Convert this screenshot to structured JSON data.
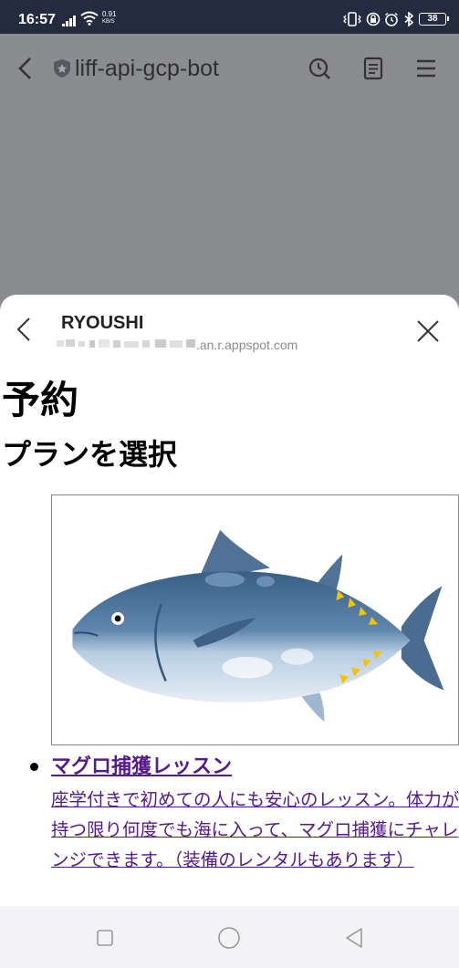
{
  "status_bar": {
    "time": "16:57",
    "net_speed_value": "0.91",
    "net_speed_unit": "KB/S",
    "battery": "38"
  },
  "header": {
    "title": "liff-api-gcp-bot",
    "icons": [
      "back-arrow-icon",
      "shield-icon",
      "history-icon",
      "note-icon",
      "menu-icon"
    ]
  },
  "sheet": {
    "title": "RYOUSHI",
    "url": ".an.r.appspot.com",
    "heading": "予約",
    "subheading": "プランを選択",
    "plans": [
      {
        "name": "マグロ捕獲レッスン",
        "description": "座学付きで初めての人にも安心のレッスン。体力が持つ限り何度でも海に入って、マグロ捕獲にチャレンジできます。（装備のレンタルもあります）"
      }
    ]
  },
  "colors": {
    "status_bar_bg": "#232b3f",
    "dim_overlay": "#8b8c90",
    "link_visited": "#551a8b"
  }
}
